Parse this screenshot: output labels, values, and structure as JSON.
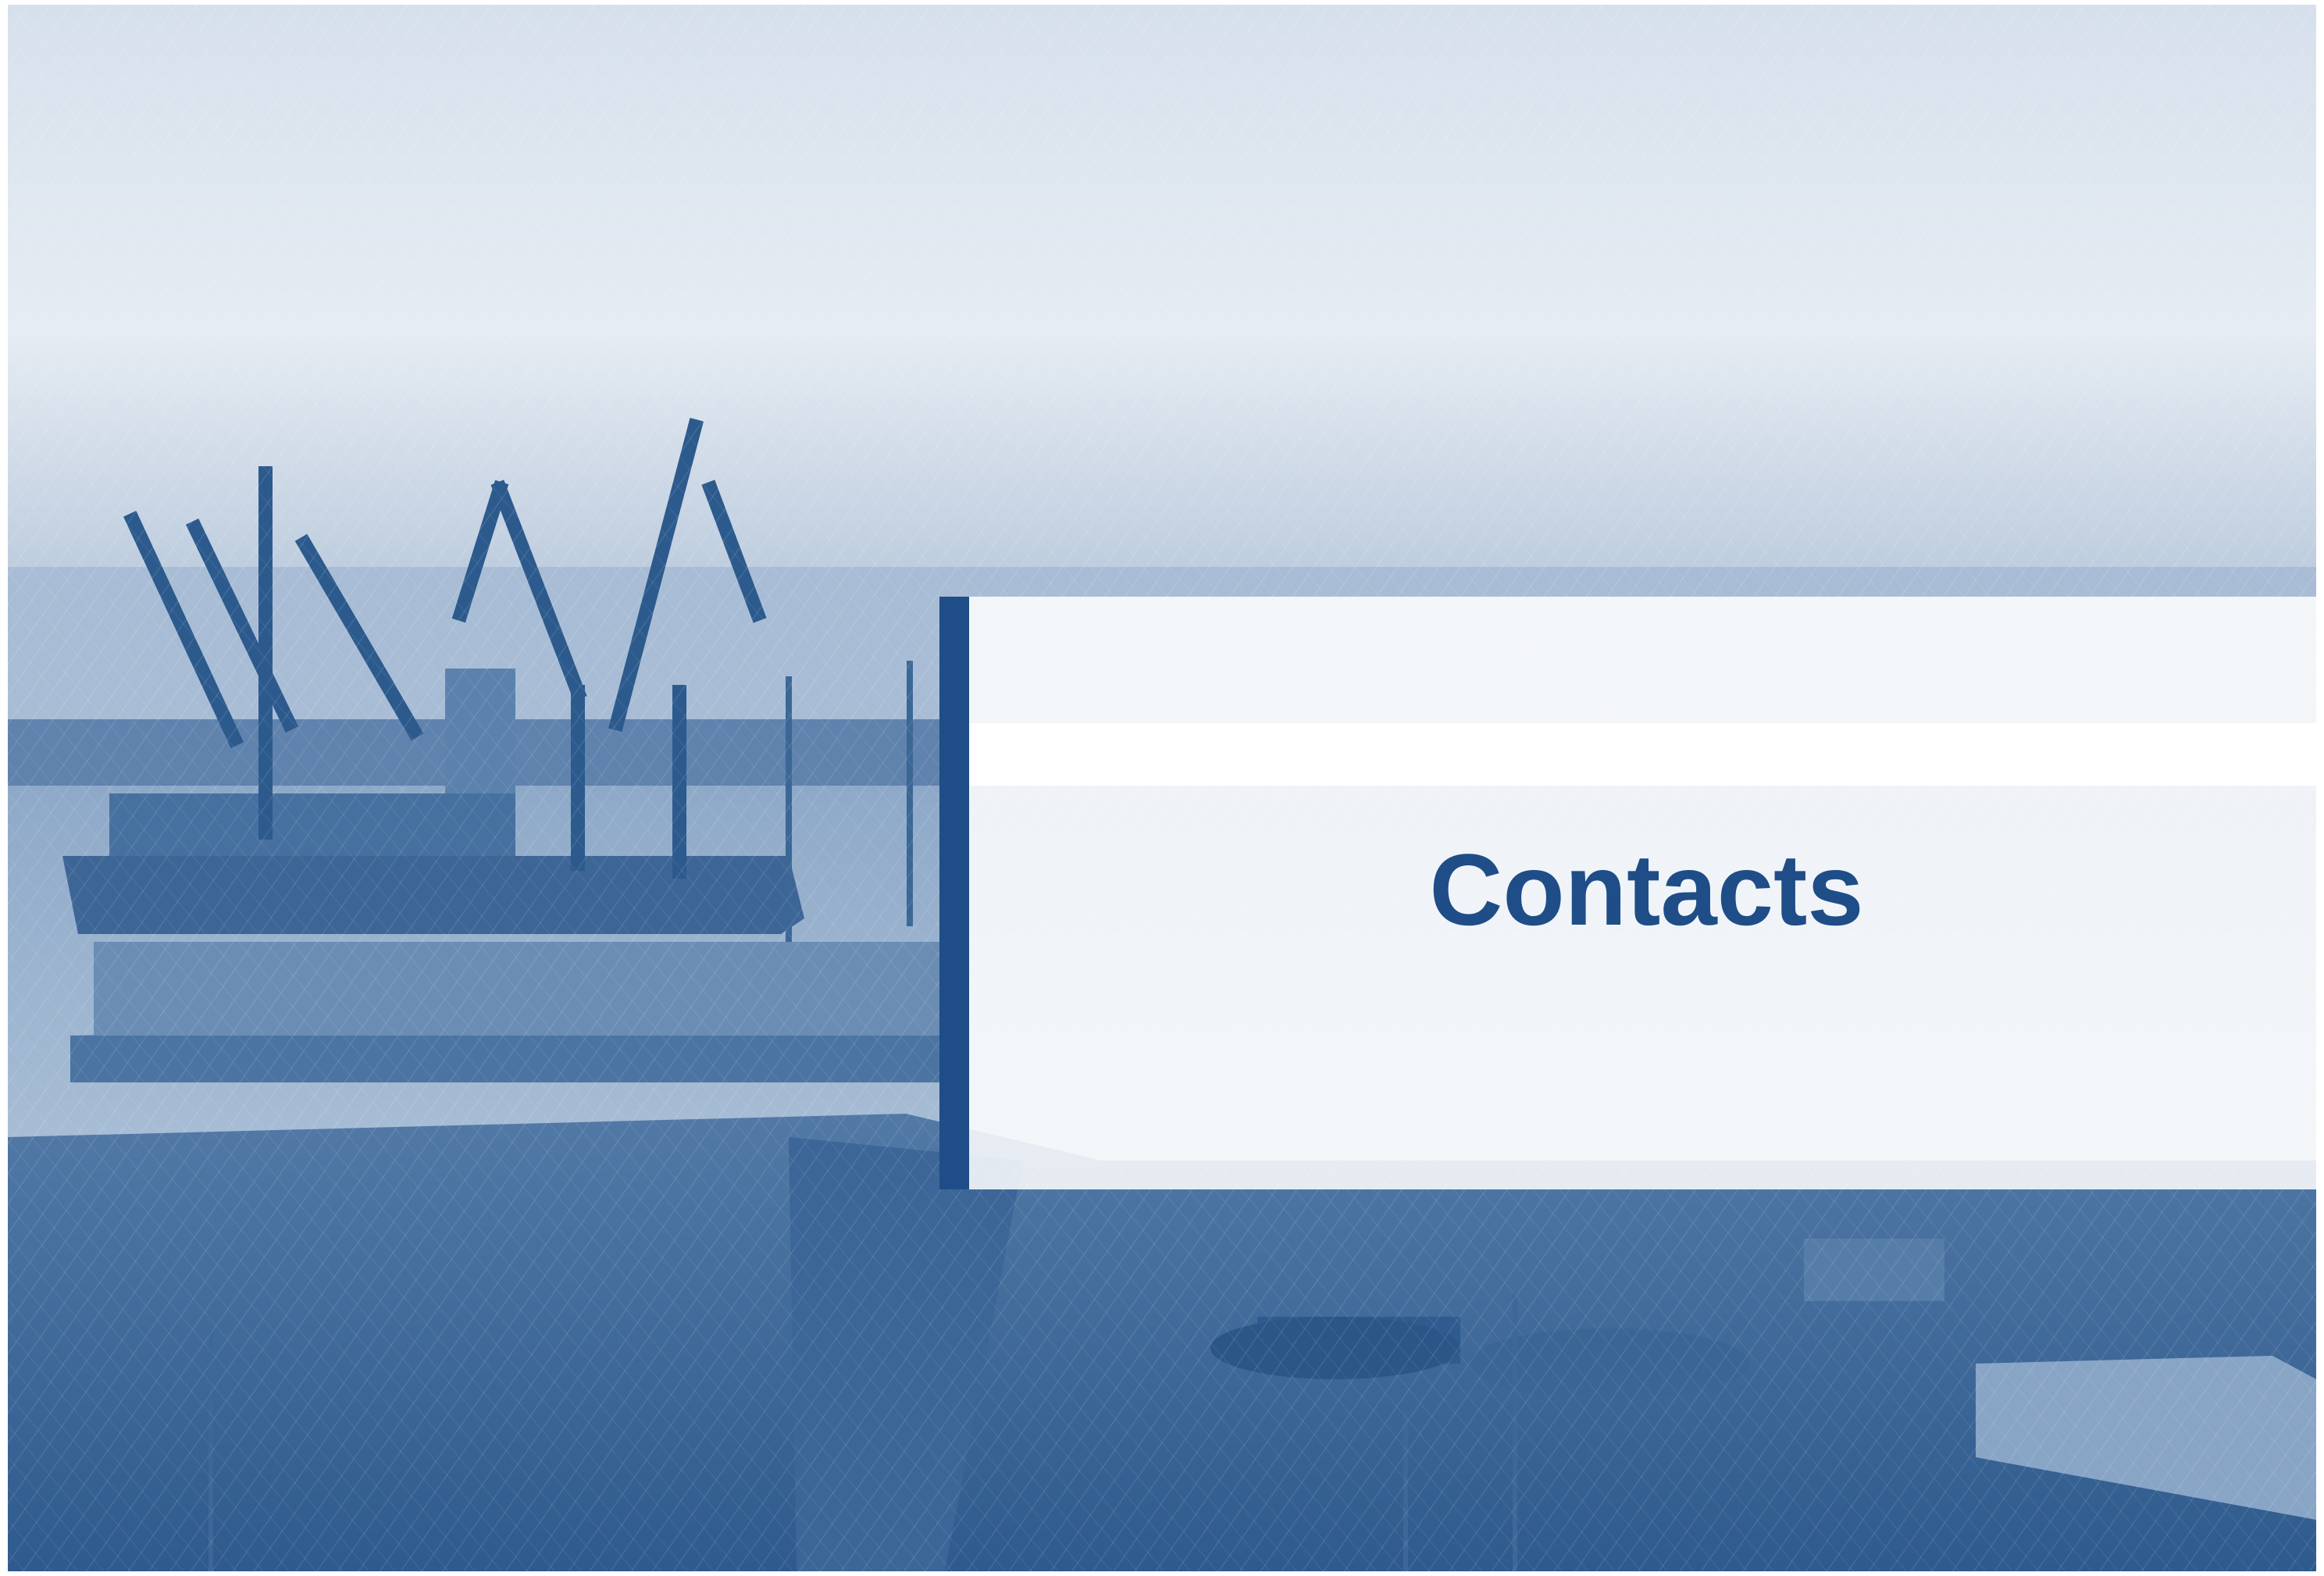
{
  "slide": {
    "title": "Contacts"
  },
  "background": {
    "subject": "port-cranes-photo-icon",
    "tint": "#2f5f96",
    "sky": "#dfe7f0"
  },
  "card": {
    "accent": "#1f4d87",
    "text_color": "#1f4d87"
  }
}
